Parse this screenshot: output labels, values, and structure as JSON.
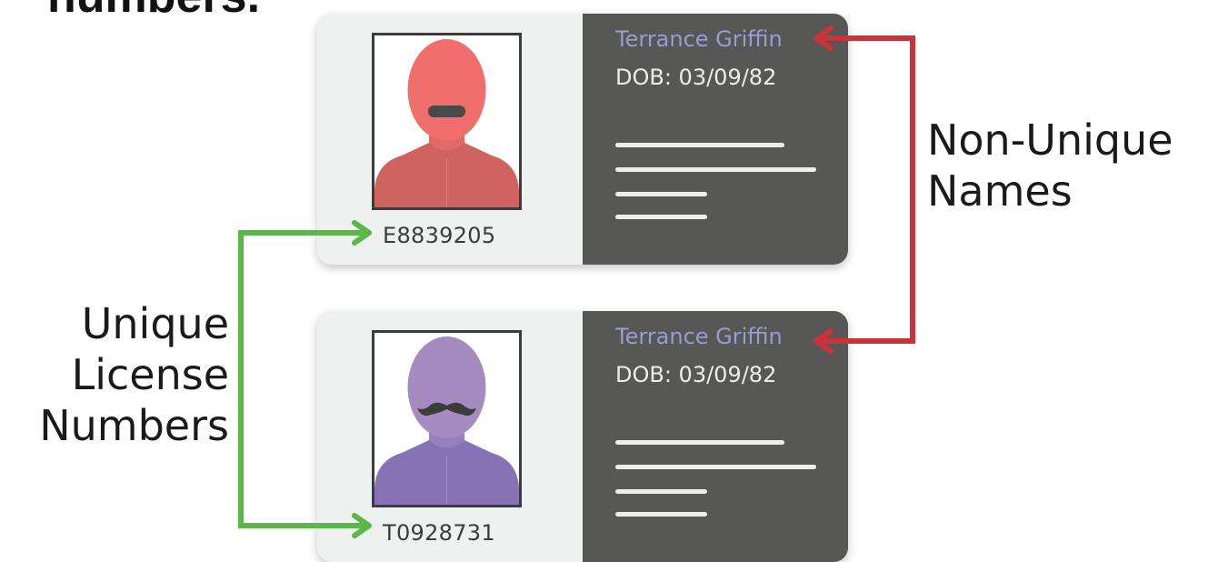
{
  "header_text": "numbers.",
  "cards": [
    {
      "name": "Terrance Griffin",
      "dob": "DOB: 03/09/82",
      "license": "E8839205",
      "avatar_color": "#f06e6c",
      "body_color": "#d06260",
      "facial_hair": "mustache-bar"
    },
    {
      "name": "Terrance Griffin",
      "dob": "DOB: 03/09/82",
      "license": "T0928731",
      "avatar_color": "#a68bc1",
      "body_color": "#8673b5",
      "facial_hair": "handlebar-mustache"
    }
  ],
  "labels": {
    "unique": [
      "Unique",
      "License",
      "Numbers"
    ],
    "non_unique": [
      "Non-Unique",
      "Names"
    ]
  },
  "colors": {
    "green_connector": "#5ab946",
    "red_connector": "#c9343b",
    "card_dark": "#575756",
    "card_light": "#eff0f0"
  }
}
